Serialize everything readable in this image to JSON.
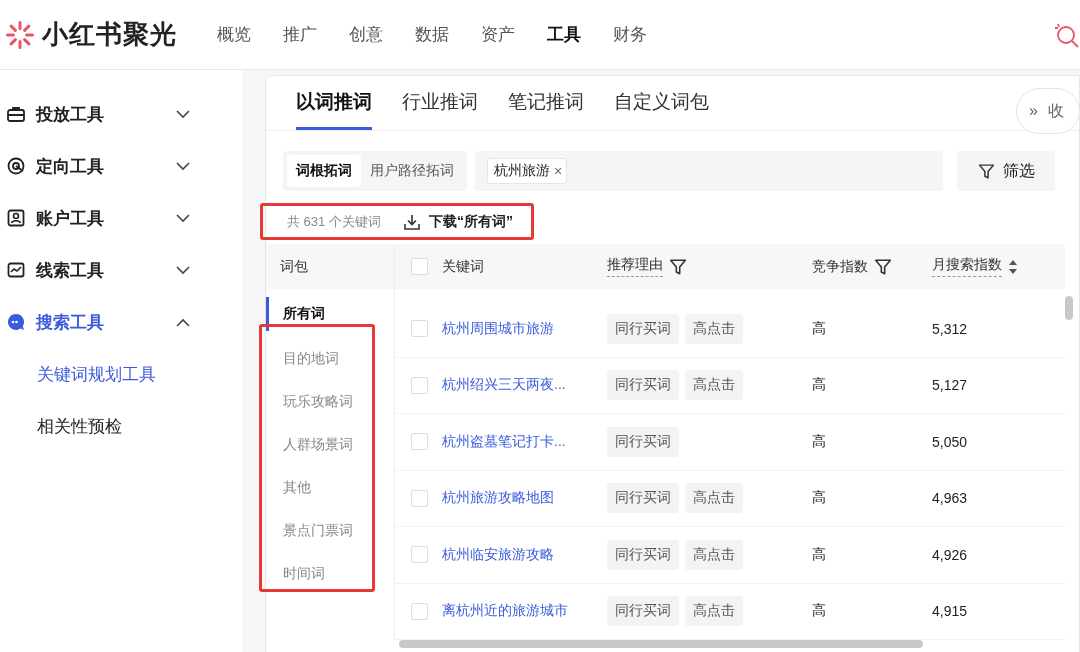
{
  "header": {
    "logo": "小红书聚光",
    "nav": [
      {
        "label": "概览",
        "selected": false
      },
      {
        "label": "推广",
        "selected": false
      },
      {
        "label": "创意",
        "selected": false
      },
      {
        "label": "数据",
        "selected": false
      },
      {
        "label": "资产",
        "selected": false
      },
      {
        "label": "工具",
        "selected": true
      },
      {
        "label": "财务",
        "selected": false
      }
    ]
  },
  "sidebar": {
    "items": [
      {
        "label": "投放工具",
        "expanded": false,
        "selected": false
      },
      {
        "label": "定向工具",
        "expanded": false,
        "selected": false
      },
      {
        "label": "账户工具",
        "expanded": false,
        "selected": false
      },
      {
        "label": "线索工具",
        "expanded": false,
        "selected": false
      },
      {
        "label": "搜索工具",
        "expanded": true,
        "selected": true,
        "children": [
          {
            "label": "关键词规划工具",
            "selected": true
          },
          {
            "label": "相关性预检",
            "selected": false
          }
        ]
      }
    ]
  },
  "tabs": [
    {
      "label": "以词推词",
      "selected": true
    },
    {
      "label": "行业推词",
      "selected": false
    },
    {
      "label": "笔记推词",
      "selected": false
    },
    {
      "label": "自定义词包",
      "selected": false
    }
  ],
  "collapse_button": {
    "icon": "»",
    "label": "收"
  },
  "mode_switch": [
    {
      "label": "词根拓词",
      "selected": true
    },
    {
      "label": "用户路径拓词",
      "selected": false
    }
  ],
  "search_tags": [
    {
      "label": "杭州旅游",
      "remove": "×"
    }
  ],
  "filter_button": "筛选",
  "summary": {
    "count": "共 631 个关键词",
    "download": "下载“所有词”",
    "highlighted": true
  },
  "word_groups": {
    "title": "词包",
    "highlighted": true,
    "items": [
      {
        "label": "所有词",
        "selected": true
      },
      {
        "label": "目的地词",
        "selected": false
      },
      {
        "label": "玩乐攻略词",
        "selected": false
      },
      {
        "label": "人群场景词",
        "selected": false
      },
      {
        "label": "其他",
        "selected": false
      },
      {
        "label": "景点门票词",
        "selected": false
      },
      {
        "label": "时间词",
        "selected": false
      }
    ]
  },
  "table": {
    "select_all_checked": false,
    "columns": [
      "关键词",
      "推荐理由",
      "竞争指数",
      "月搜索指数"
    ],
    "rows": [
      {
        "checked": false,
        "keyword": "杭州周围城市旅游",
        "reasons": [
          "同行买词",
          "高点击"
        ],
        "competition": "高",
        "monthly": "5,312"
      },
      {
        "checked": false,
        "keyword": "杭州绍兴三天两夜...",
        "reasons": [
          "同行买词",
          "高点击"
        ],
        "competition": "高",
        "monthly": "5,127"
      },
      {
        "checked": false,
        "keyword": "杭州盗墓笔记打卡...",
        "reasons": [
          "同行买词"
        ],
        "competition": "高",
        "monthly": "5,050"
      },
      {
        "checked": false,
        "keyword": "杭州旅游攻略地图",
        "reasons": [
          "同行买词",
          "高点击"
        ],
        "competition": "高",
        "monthly": "4,963"
      },
      {
        "checked": false,
        "keyword": "杭州临安旅游攻略",
        "reasons": [
          "同行买词",
          "高点击"
        ],
        "competition": "高",
        "monthly": "4,926"
      },
      {
        "checked": false,
        "keyword": "离杭州近的旅游城市",
        "reasons": [
          "同行买词",
          "高点击"
        ],
        "competition": "高",
        "monthly": "4,915"
      }
    ]
  }
}
